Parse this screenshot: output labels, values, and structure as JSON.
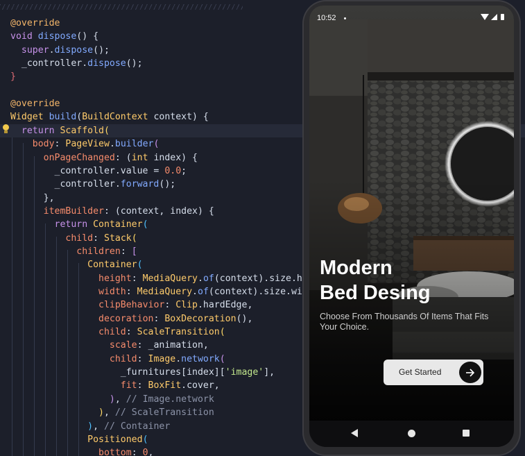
{
  "editor": {
    "lines": [
      {
        "segs": [
          [
            "anno",
            "@override"
          ]
        ]
      },
      {
        "segs": [
          [
            "kw",
            "void "
          ],
          [
            "fn",
            "dispose"
          ],
          [
            "pl",
            "() {"
          ]
        ]
      },
      {
        "segs": [
          [
            "pl",
            "  "
          ],
          [
            "kw",
            "super"
          ],
          [
            "pl",
            "."
          ],
          [
            "fn",
            "dispose"
          ],
          [
            "pl",
            "();"
          ]
        ]
      },
      {
        "segs": [
          [
            "pl",
            "  _controller."
          ],
          [
            "fn",
            "dispose"
          ],
          [
            "pl",
            "();"
          ]
        ]
      },
      {
        "segs": [
          [
            "brR",
            "}"
          ]
        ]
      },
      {
        "segs": []
      },
      {
        "segs": [
          [
            "anno",
            "@override"
          ]
        ]
      },
      {
        "segs": [
          [
            "ty",
            "Widget "
          ],
          [
            "fn",
            "build"
          ],
          [
            "pl",
            "("
          ],
          [
            "ty",
            "BuildContext "
          ],
          [
            "pl",
            "context) {"
          ]
        ]
      },
      {
        "segs": [
          [
            "pl",
            "  "
          ],
          [
            "kw",
            "return "
          ],
          [
            "ty",
            "Scaffold"
          ],
          [
            "brY",
            "("
          ]
        ]
      },
      {
        "segs": [
          [
            "pl",
            "    "
          ],
          [
            "pr",
            "body"
          ],
          [
            "pl",
            ": "
          ],
          [
            "ty",
            "PageView"
          ],
          [
            "pl",
            "."
          ],
          [
            "fn",
            "builder"
          ],
          [
            "brP",
            "("
          ]
        ]
      },
      {
        "segs": [
          [
            "pl",
            "      "
          ],
          [
            "pr",
            "onPageChanged"
          ],
          [
            "pl",
            ": ("
          ],
          [
            "ty",
            "int "
          ],
          [
            "pl",
            "index) {"
          ]
        ]
      },
      {
        "segs": [
          [
            "pl",
            "        _controller.value = "
          ],
          [
            "nu",
            "0.0"
          ],
          [
            "pl",
            ";"
          ]
        ]
      },
      {
        "segs": [
          [
            "pl",
            "        _controller."
          ],
          [
            "fn",
            "forward"
          ],
          [
            "pl",
            "();"
          ]
        ]
      },
      {
        "segs": [
          [
            "pl",
            "      },"
          ]
        ]
      },
      {
        "segs": [
          [
            "pl",
            "      "
          ],
          [
            "pr",
            "itemBuilder"
          ],
          [
            "pl",
            ": (context, index) {"
          ]
        ]
      },
      {
        "segs": [
          [
            "pl",
            "        "
          ],
          [
            "kw",
            "return "
          ],
          [
            "ty",
            "Container"
          ],
          [
            "brB",
            "("
          ]
        ]
      },
      {
        "segs": [
          [
            "pl",
            "          "
          ],
          [
            "pr",
            "child"
          ],
          [
            "pl",
            ": "
          ],
          [
            "ty",
            "Stack"
          ],
          [
            "brY",
            "("
          ]
        ]
      },
      {
        "segs": [
          [
            "pl",
            "            "
          ],
          [
            "pr",
            "children"
          ],
          [
            "pl",
            ": "
          ],
          [
            "brP",
            "["
          ]
        ]
      },
      {
        "segs": [
          [
            "pl",
            "              "
          ],
          [
            "ty",
            "Container"
          ],
          [
            "brB",
            "("
          ]
        ]
      },
      {
        "segs": [
          [
            "pl",
            "                "
          ],
          [
            "pr",
            "height"
          ],
          [
            "pl",
            ": "
          ],
          [
            "ty",
            "MediaQuery"
          ],
          [
            "pl",
            "."
          ],
          [
            "fn",
            "of"
          ],
          [
            "pl",
            "(context).size.h"
          ]
        ]
      },
      {
        "segs": [
          [
            "pl",
            "                "
          ],
          [
            "pr",
            "width"
          ],
          [
            "pl",
            ": "
          ],
          [
            "ty",
            "MediaQuery"
          ],
          [
            "pl",
            "."
          ],
          [
            "fn",
            "of"
          ],
          [
            "pl",
            "(context).size.wi"
          ]
        ]
      },
      {
        "segs": [
          [
            "pl",
            "                "
          ],
          [
            "pr",
            "clipBehavior"
          ],
          [
            "pl",
            ": "
          ],
          [
            "ty",
            "Clip"
          ],
          [
            "pl",
            ".hardEdge,"
          ]
        ]
      },
      {
        "segs": [
          [
            "pl",
            "                "
          ],
          [
            "pr",
            "decoration"
          ],
          [
            "pl",
            ": "
          ],
          [
            "ty",
            "BoxDecoration"
          ],
          [
            "pl",
            "(),"
          ]
        ]
      },
      {
        "segs": [
          [
            "pl",
            "                "
          ],
          [
            "pr",
            "child"
          ],
          [
            "pl",
            ": "
          ],
          [
            "ty",
            "ScaleTransition"
          ],
          [
            "brY",
            "("
          ]
        ]
      },
      {
        "segs": [
          [
            "pl",
            "                  "
          ],
          [
            "pr",
            "scale"
          ],
          [
            "pl",
            ": _animation,"
          ]
        ]
      },
      {
        "segs": [
          [
            "pl",
            "                  "
          ],
          [
            "pr",
            "child"
          ],
          [
            "pl",
            ": "
          ],
          [
            "ty",
            "Image"
          ],
          [
            "pl",
            "."
          ],
          [
            "fn",
            "network"
          ],
          [
            "brP",
            "("
          ]
        ]
      },
      {
        "segs": [
          [
            "pl",
            "                    _furnitures[index]["
          ],
          [
            "st",
            "'image'"
          ],
          [
            "pl",
            "],"
          ]
        ]
      },
      {
        "segs": [
          [
            "pl",
            "                    "
          ],
          [
            "pr",
            "fit"
          ],
          [
            "pl",
            ": "
          ],
          [
            "ty",
            "BoxFit"
          ],
          [
            "pl",
            ".cover,"
          ]
        ]
      },
      {
        "segs": [
          [
            "pl",
            "                  "
          ],
          [
            "brP",
            ")"
          ],
          [
            "pl",
            ", "
          ],
          [
            "cm",
            "// Image.network"
          ]
        ]
      },
      {
        "segs": [
          [
            "pl",
            "                "
          ],
          [
            "brY",
            ")"
          ],
          [
            "pl",
            ", "
          ],
          [
            "cm",
            "// ScaleTransition"
          ]
        ]
      },
      {
        "segs": [
          [
            "pl",
            "              "
          ],
          [
            "brB",
            ")"
          ],
          [
            "pl",
            ", "
          ],
          [
            "cm",
            "// Container"
          ]
        ]
      },
      {
        "segs": [
          [
            "pl",
            "              "
          ],
          [
            "ty",
            "Positioned"
          ],
          [
            "brB",
            "("
          ]
        ]
      },
      {
        "segs": [
          [
            "pl",
            "                "
          ],
          [
            "pr",
            "bottom"
          ],
          [
            "pl",
            ": "
          ],
          [
            "nu",
            "0"
          ],
          [
            "pl",
            ","
          ]
        ]
      }
    ]
  },
  "phone": {
    "status": {
      "time": "10:52"
    },
    "title_line1": "Modern",
    "title_line2": "Bed Desing",
    "subtitle": "Choose From Thousands Of Items That Fits Your Choice.",
    "cta_label": "Get Started",
    "icons": [
      "arrow-right-icon",
      "back-icon",
      "home-icon",
      "recents-icon",
      "wifi-icon",
      "signal-icon",
      "battery-icon"
    ]
  }
}
